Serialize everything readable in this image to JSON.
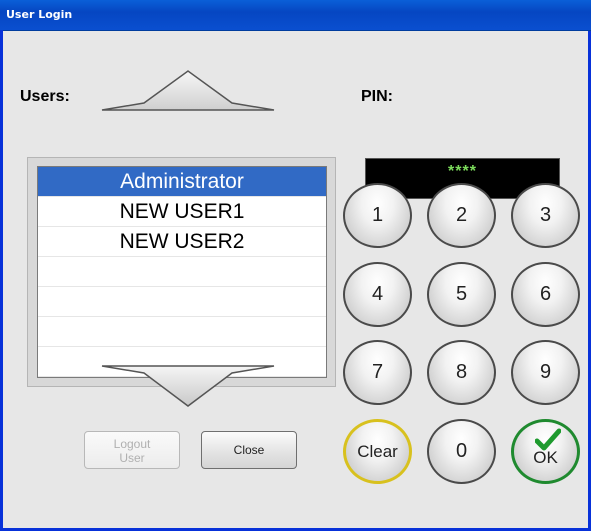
{
  "window": {
    "title": "User Login"
  },
  "users": {
    "label": "Users:",
    "items": [
      {
        "name": "Administrator",
        "selected": true
      },
      {
        "name": "NEW USER1",
        "selected": false
      },
      {
        "name": "NEW USER2",
        "selected": false
      },
      {
        "name": "",
        "selected": false
      },
      {
        "name": "",
        "selected": false
      },
      {
        "name": "",
        "selected": false
      },
      {
        "name": "",
        "selected": false
      }
    ]
  },
  "pin": {
    "label": "PIN:",
    "value": "****"
  },
  "keypad": {
    "k1": "1",
    "k2": "2",
    "k3": "3",
    "k4": "4",
    "k5": "5",
    "k6": "6",
    "k7": "7",
    "k8": "8",
    "k9": "9",
    "clear": "Clear",
    "k0": "0",
    "ok": "OK"
  },
  "buttons": {
    "logout_line1": "Logout",
    "logout_line2": "User",
    "close": "Close"
  },
  "colors": {
    "selection": "#316ac5",
    "pin_text": "#7cdc5c",
    "clear_ring": "#d8c11e",
    "ok_ring": "#1f8a2f"
  }
}
